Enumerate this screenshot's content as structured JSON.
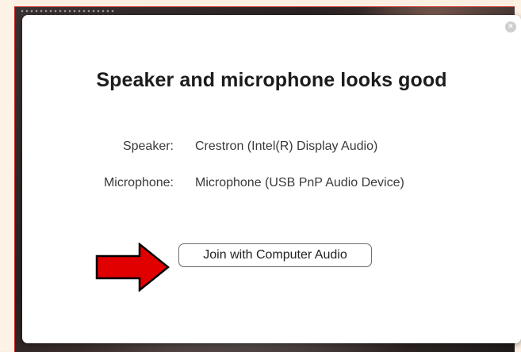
{
  "dialog": {
    "title": "Speaker and microphone looks good",
    "close_symbol": "×",
    "speaker": {
      "label": "Speaker:",
      "value": "Crestron (Intel(R) Display Audio)"
    },
    "microphone": {
      "label": "Microphone:",
      "value": "Microphone (USB PnP Audio Device)"
    },
    "join_button_label": "Join with Computer Audio"
  },
  "colors": {
    "arrow_fill": "#e00000",
    "arrow_stroke": "#000000",
    "frame_border": "#c3231d",
    "page_background": "#fbefe2"
  },
  "icons": {
    "close": "close-icon",
    "pointer": "red-arrow-icon"
  }
}
